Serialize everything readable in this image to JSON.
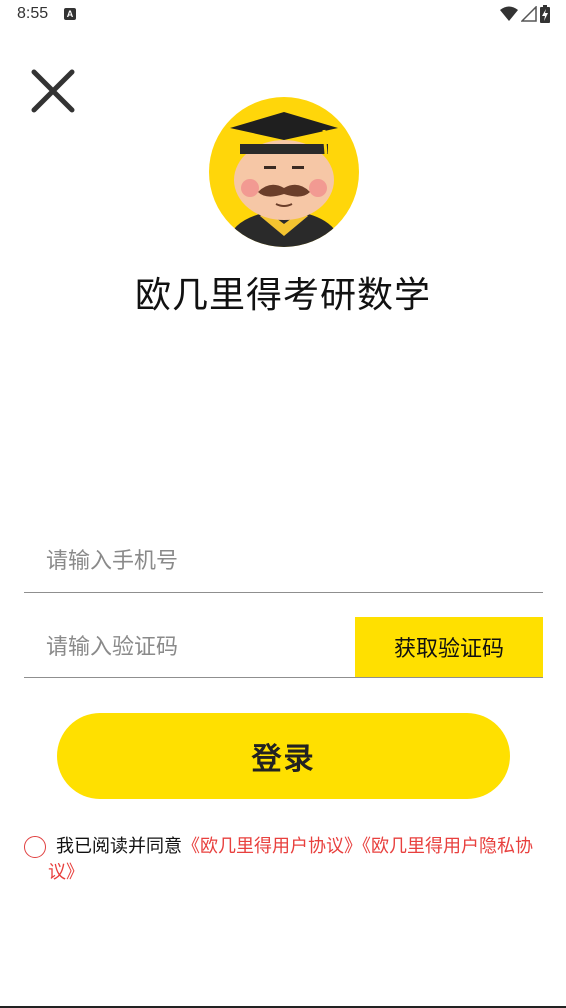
{
  "status_bar": {
    "time": "8:55",
    "notification_icon": "A"
  },
  "header": {
    "close_icon": "close-icon"
  },
  "app": {
    "title": "欧几里得考研数学"
  },
  "form": {
    "phone_placeholder": "请输入手机号",
    "code_placeholder": "请输入验证码",
    "get_code_label": "获取验证码",
    "login_label": "登录"
  },
  "agreement": {
    "prefix": "我已阅读并同意",
    "user_agreement": "《欧几里得用户协议》",
    "privacy_agreement": "《欧几里得用户隐私协议》"
  },
  "colors": {
    "accent": "#ffe000",
    "link": "#e8403e"
  }
}
